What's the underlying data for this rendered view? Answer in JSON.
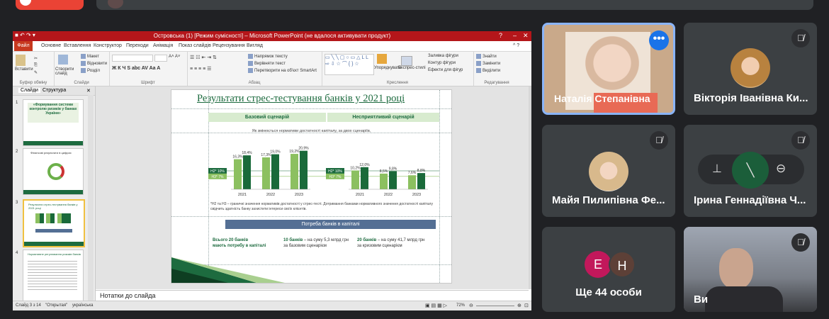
{
  "meet": {
    "top_bar": {
      "left_button": "",
      "search_text": ""
    },
    "participants": [
      {
        "name": "Наталія Степанівна",
        "muted": false,
        "speaking": true,
        "more_icon": "more-dots-icon"
      },
      {
        "name": "Вікторія Іванівна Ки...",
        "muted": true
      },
      {
        "name": "Майя Пилипівна Фе...",
        "muted": true
      },
      {
        "name": "Ірина Геннадіївна Ч...",
        "muted": true,
        "hover_controls": [
          "pin-icon",
          "mute-icon",
          "remove-icon"
        ]
      },
      {
        "name": "Ще 44 особи",
        "avatars": [
          "Е",
          "Н"
        ],
        "avatar_colors": [
          "#c2185b",
          "#5d4037"
        ]
      },
      {
        "name": "Ви",
        "muted": true
      }
    ]
  },
  "powerpoint": {
    "title": "Островська (1) [Режим сумісності] – Microsoft PowerPoint (не вдалося активувати продукт)",
    "tabs": [
      "Файл",
      "Основне",
      "Вставлення",
      "Конструктор",
      "Переходи",
      "Анімація",
      "Показ слайдів",
      "Рецензування",
      "Вигляд"
    ],
    "ribbon": {
      "clipboard": {
        "paste": "Вставити",
        "label": "Буфер обміну"
      },
      "slides": {
        "new_slide": "Створити слайд",
        "layout": "Макет",
        "reset": "Відновити",
        "section": "Розділ",
        "label": "Слайди"
      },
      "font": {
        "label": "Шрифт"
      },
      "paragraph": {
        "direction": "Напрямок тексту",
        "align": "Вирівняти текст",
        "smartart": "Перетворити на об'єкт SmartArt",
        "label": "Абзац"
      },
      "drawing": {
        "arrange": "Упорядкувати",
        "styles": "Експрес-стилі",
        "fill": "Заливка фігури",
        "outline": "Контур фігури",
        "effects": "Ефекти для фігур",
        "label": "Креслення"
      },
      "editing": {
        "find": "Знайти",
        "replace": "Замінити",
        "select": "Виділити",
        "label": "Редагування"
      }
    },
    "panel_tabs": [
      "Слайди",
      "Структура"
    ],
    "thumbnails": [
      {
        "num": "1",
        "title": "«Формування системи контролю ризиків у банках України»"
      },
      {
        "num": "2",
        "title": "Фінансові результати в цифрах"
      },
      {
        "num": "3",
        "title": "Результати стрес-тестування банків у 2021 році"
      },
      {
        "num": "4",
        "title": "Нормативне регулювання ризиків банків"
      }
    ],
    "notes_placeholder": "Нотатки до слайда",
    "status": {
      "slide": "Слайд 3 з 14",
      "theme": "\"Открытая\"",
      "lang": "українська",
      "zoom": "72%"
    }
  },
  "slide": {
    "title": "Результати стрес-тестування банків у 2021 році",
    "base_label": "Базовий сценарій",
    "adverse_label": "Несприятливий сценарій",
    "note": "Як змінюється нормативи достатності капіталу, за двох сценаріїв,",
    "h2_tag": "Н2* 10%",
    "h3_tag": "Н3* 7%",
    "footnote": "*Н2 та Н3 – граничні значення нормативів достатності у стрес-тесті. Дотримання банками нормативного значення достатності капіталу свідчить здатність банку захистити інтереси своїх клієнтів.",
    "needs_header": "Потреба банків в капіталі",
    "needs": [
      {
        "bold": "Всього 20 банків",
        "text": "мають потребу в капіталі"
      },
      {
        "bold": "10 банків",
        "text": "– на суму 5,3 млрд грн за базовим сценарієм"
      },
      {
        "bold": "20 банків",
        "text": "– на суму 41,7 млрд грн за кризовим сценарієм"
      }
    ]
  },
  "chart_data": {
    "type": "bar",
    "categories": [
      "2021",
      "2022",
      "2023"
    ],
    "series": [
      {
        "scenario": "Базовий сценарій",
        "values": [
          16.3,
          17.3,
          19.2
        ]
      },
      {
        "scenario": "Базовий сценарій",
        "values": [
          18.4,
          19.0,
          20.9
        ]
      },
      {
        "scenario": "Несприятливий сценарій",
        "values": [
          10.2,
          8.5,
          7.6
        ]
      },
      {
        "scenario": "Несприятливий сценарій",
        "values": [
          12.0,
          9.8,
          8.8
        ]
      }
    ],
    "value_labels": {
      "base_light": [
        "16,3%",
        "17,3%",
        "19,2%"
      ],
      "base_dark": [
        "18,4%",
        "19,0%",
        "20,9%"
      ],
      "adv_light": [
        "10,2%",
        "8,5%",
        "7,6%"
      ],
      "adv_dark": [
        "12,0%",
        "9,8%",
        "8,8%"
      ]
    },
    "colors": {
      "light": "#8cc060",
      "dark": "#1a6a3a"
    },
    "thresholds": {
      "H2": 10,
      "H3": 7
    }
  }
}
